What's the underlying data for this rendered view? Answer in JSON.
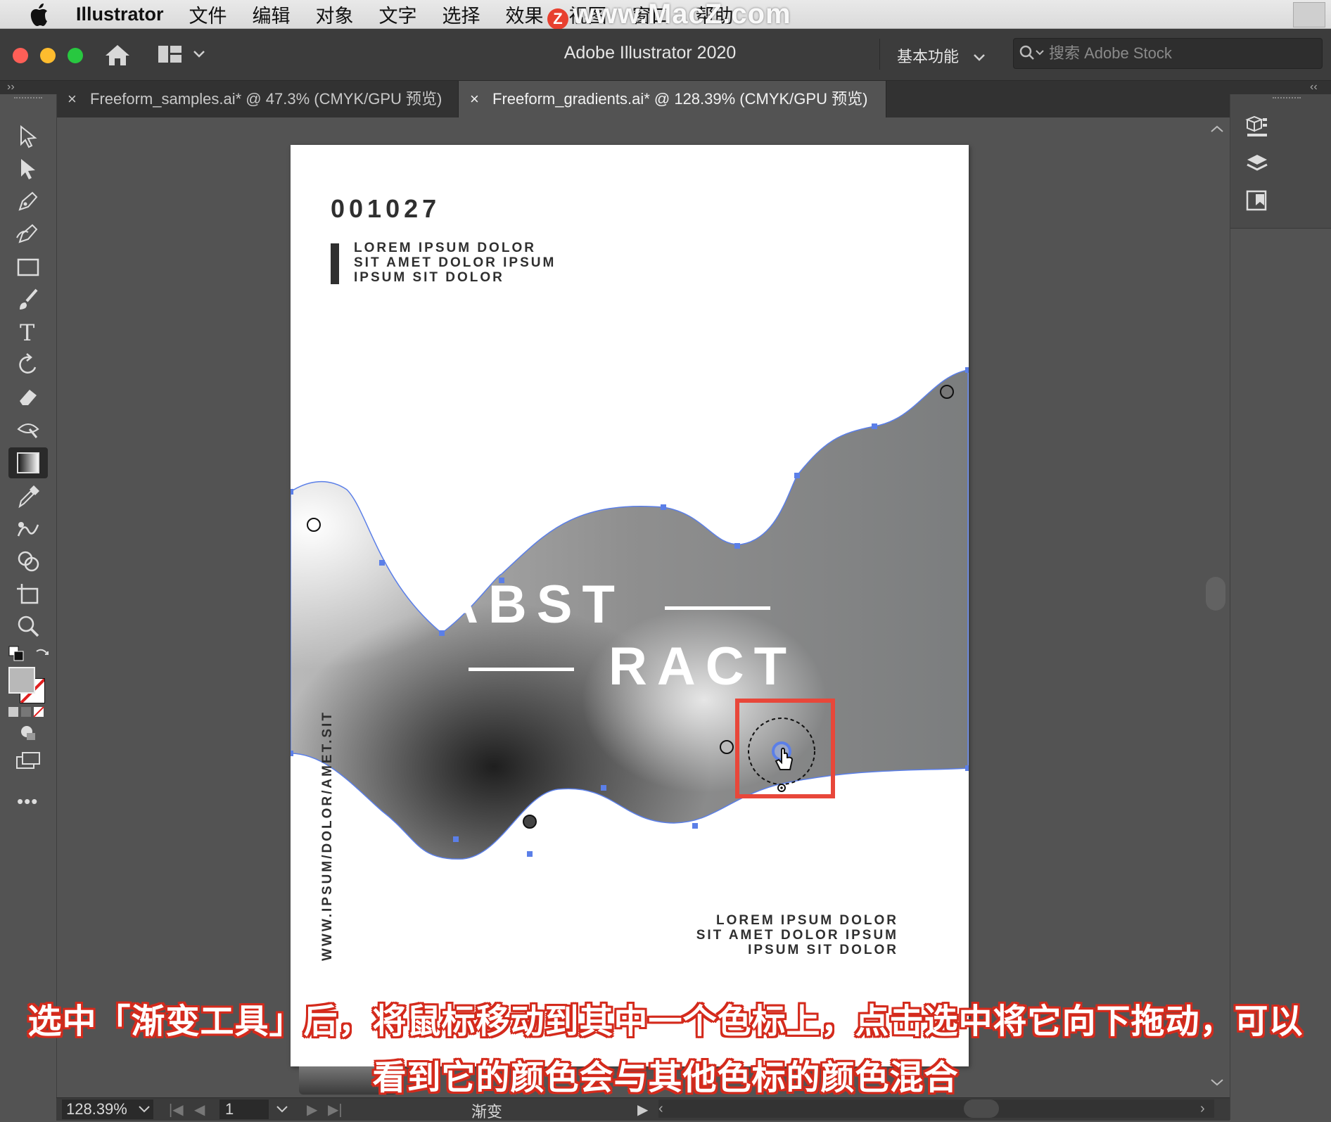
{
  "menubar": {
    "app_name": "Illustrator",
    "items": [
      "文件",
      "编辑",
      "对象",
      "文字",
      "选择",
      "效果",
      "视图",
      "窗口",
      "帮助"
    ]
  },
  "watermark": {
    "text": "www.MacZ.com",
    "badge": "Z"
  },
  "titlebar": {
    "title": "Adobe Illustrator 2020",
    "workspace": "基本功能",
    "search_placeholder": "搜索 Adobe Stock"
  },
  "tabs": [
    {
      "label": "Freeform_samples.ai* @ 47.3% (CMYK/GPU 预览)",
      "active": false
    },
    {
      "label": "Freeform_gradients.ai* @ 128.39% (CMYK/GPU 预览)",
      "active": true
    }
  ],
  "tools": [
    "selection-tool-icon",
    "direct-selection-tool-icon",
    "pen-tool-icon",
    "curvature-tool-icon",
    "rectangle-tool-icon",
    "paintbrush-tool-icon",
    "type-tool-icon",
    "rotate-tool-icon",
    "eraser-tool-icon",
    "width-tool-icon",
    "gradient-tool-icon",
    "eyedropper-tool-icon",
    "blend-tool-icon",
    "shape-builder-tool-icon",
    "artboard-tool-icon",
    "zoom-tool-icon"
  ],
  "selected_tool": "gradient-tool-icon",
  "right_panel_icons": [
    "properties-icon",
    "layers-icon",
    "libraries-icon"
  ],
  "poster": {
    "number": "001027",
    "lines_top": [
      "LOREM IPSUM DOLOR",
      "SIT AMET DOLOR IPSUM",
      "IPSUM SIT DOLOR"
    ],
    "title_line1": "ABST",
    "title_line2": "RACT",
    "lines_bottom": [
      "LOREM IPSUM DOLOR",
      "SIT AMET DOLOR IPSUM",
      "IPSUM SIT DOLOR"
    ],
    "vertical_url": "WWW.IPSUM/DOLOR/AMET.SIT"
  },
  "statusbar": {
    "zoom": "128.39%",
    "page": "1",
    "tool_name": "渐变"
  },
  "caption": {
    "line1": "选中「渐变工具」后，将鼠标移动到其中一个色标上，点击选中将它向下拖动，可以",
    "line2": "看到它的颜色会与其他色标的颜色混合"
  },
  "colors": {
    "highlight_box": "#e8473a",
    "gradient_mesh_outline": "#5b7fe8",
    "caption_outline": "#d42a1c"
  }
}
